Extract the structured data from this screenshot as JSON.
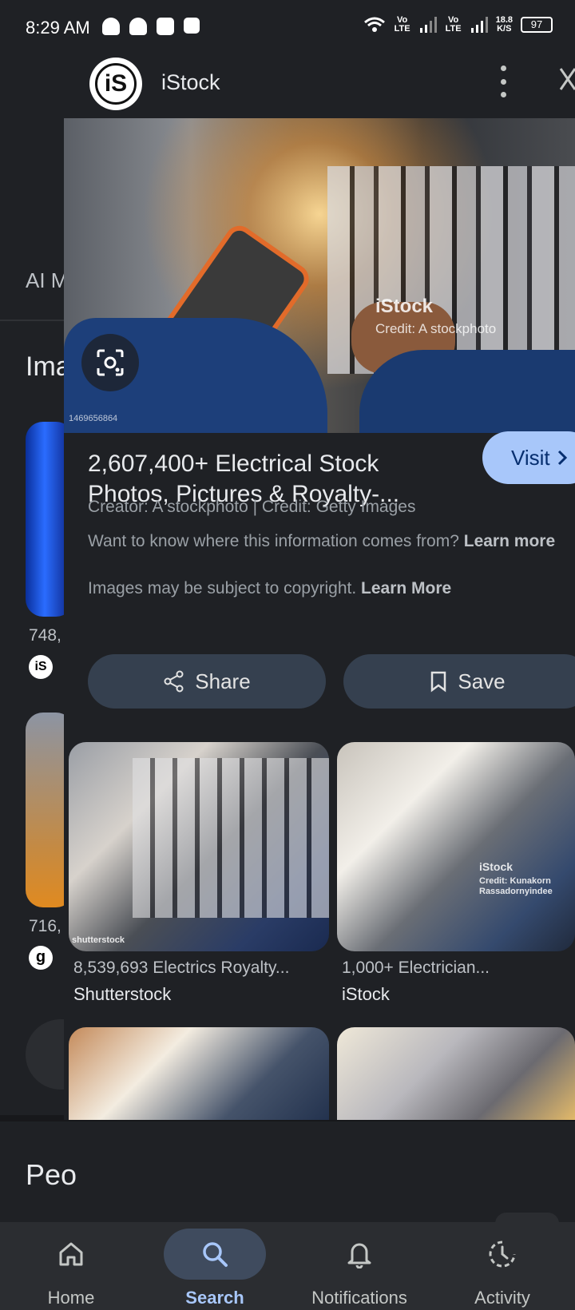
{
  "status_bar": {
    "time": "8:29 AM",
    "net_speed_value": "18.8",
    "net_speed_unit": "K/S",
    "battery": "97",
    "signal_label_1": "Vo LTE",
    "signal_label_2": "Vo LTE"
  },
  "background_page": {
    "section_ai": "AI M",
    "section_images": "Ima",
    "result1_count": "748,",
    "result2_count": "716,",
    "section_people": "Peo"
  },
  "overlay": {
    "site_name": "iStock",
    "logo_text": "iS",
    "hero_watermark_brand": "iStock",
    "hero_watermark_credit": "Credit: A stockphoto",
    "hero_image_id": "1469656864",
    "title": "2,607,400+ Electrical Stock Photos, Pictures & Royalty-...",
    "visit_label": "Visit",
    "creator_line": "Creator: A stockphoto | Credit: Getty Images",
    "info_text": "Want to know where this information comes from?",
    "info_link": "Learn more",
    "copyright_text": "Images may be subject to copyright.",
    "copyright_link": "Learn More",
    "share_label": "Share",
    "save_label": "Save",
    "related": [
      {
        "label": "8,539,693 Electrics Royalty...",
        "source": "Shutterstock",
        "watermark": "shutterstock"
      },
      {
        "label": "1,000+ Electrician...",
        "source": "iStock",
        "watermark": "iStock",
        "watermark_credit": "Credit: Kunakorn Rassadornyindee"
      }
    ]
  },
  "bottom_nav": {
    "items": [
      {
        "label": "Home",
        "icon": "home-icon"
      },
      {
        "label": "Search",
        "icon": "search-icon",
        "active": true
      },
      {
        "label": "Notifications",
        "icon": "bell-icon"
      },
      {
        "label": "Activity",
        "icon": "activity-icon"
      }
    ]
  },
  "colors": {
    "background": "#1f2125",
    "accent": "#a8c7fa",
    "pill": "#35404f"
  }
}
